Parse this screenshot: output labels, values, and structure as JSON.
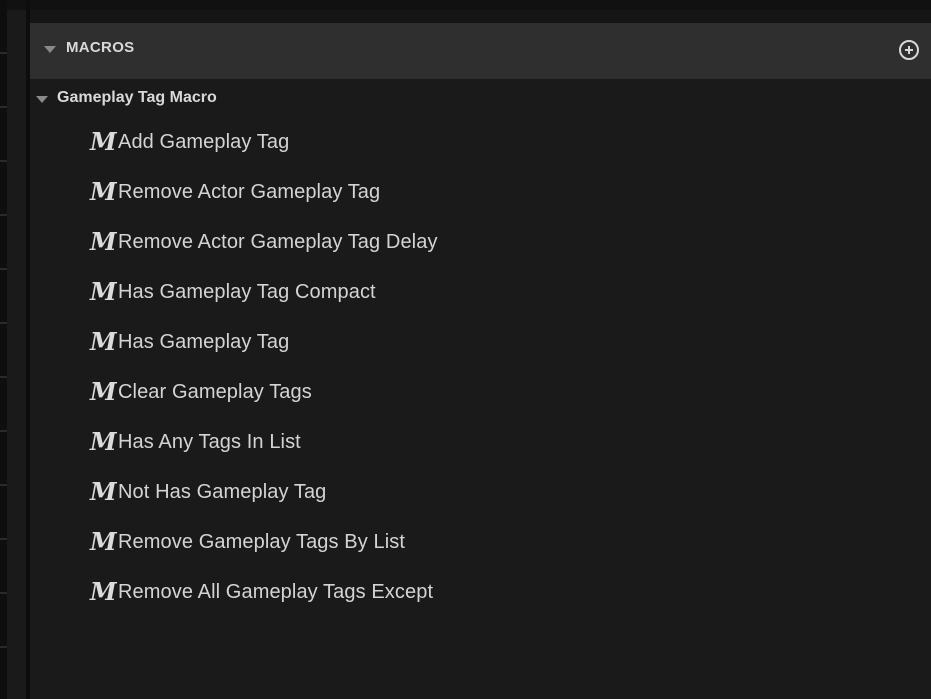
{
  "section": {
    "title": "MACROS",
    "add_icon": "add-circle-icon"
  },
  "category": {
    "label": "Gameplay Tag Macro"
  },
  "macro_icon_glyph": "M",
  "items": [
    {
      "label": "Add Gameplay Tag"
    },
    {
      "label": "Remove Actor Gameplay Tag"
    },
    {
      "label": "Remove Actor Gameplay Tag Delay"
    },
    {
      "label": "Has Gameplay Tag Compact"
    },
    {
      "label": "Has Gameplay Tag"
    },
    {
      "label": "Clear Gameplay Tags"
    },
    {
      "label": "Has Any Tags In List"
    },
    {
      "label": "Not Has Gameplay Tag"
    },
    {
      "label": "Remove Gameplay Tags By List"
    },
    {
      "label": "Remove All Gameplay Tags Except"
    }
  ]
}
